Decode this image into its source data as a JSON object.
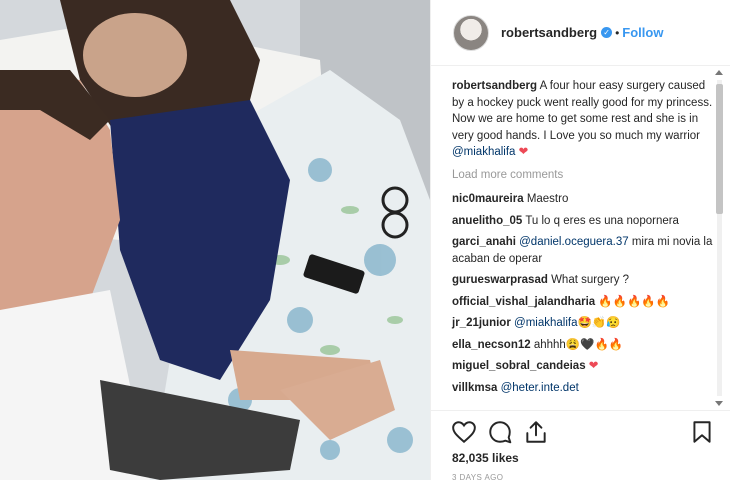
{
  "post": {
    "username": "robertsandberg",
    "separator": "•",
    "follow_label": "Follow",
    "verified_icon": "verified-badge-icon",
    "caption_user": "robertsandberg",
    "caption_text": "A four hour easy surgery caused by a hockey puck went really good for my princess.\nNow we are home to get some rest and she is in very good hands. I Love you so much my warrior ",
    "caption_mention": "@miakhalifa",
    "caption_emoji": "❤",
    "load_more": "Load more comments",
    "likes": "82,035 likes",
    "time": "3 DAYS AGO"
  },
  "comments": [
    {
      "user": "nic0maureira",
      "text": "Maestro"
    },
    {
      "user": "anuelitho_05",
      "text": "Tu lo q eres es una nopornera"
    },
    {
      "user": "garci_anahi",
      "mention": "@daniel.oceguera.37",
      "text": " mira mi novia la acaban de operar"
    },
    {
      "user": "gurueswarprasad",
      "text": "What surgery ?"
    },
    {
      "user": "official_vishal_jalandharia",
      "text": "🔥🔥🔥🔥🔥"
    },
    {
      "user": "jr_21junior",
      "mention": "@miakhalifa",
      "text": "🤩👏😥"
    },
    {
      "user": "ella_necson12",
      "text": "ahhhh😩🖤🔥🔥"
    },
    {
      "user": "miguel_sobral_candeias",
      "text": "❤"
    },
    {
      "user": "villkmsa",
      "mention": "@heter.inte.det",
      "text": ""
    }
  ],
  "icons": [
    "heart-icon",
    "comment-icon",
    "share-icon",
    "bookmark-icon"
  ],
  "colors": {
    "accent": "#3897f0",
    "mention": "#003569",
    "heart": "#ed4956"
  }
}
